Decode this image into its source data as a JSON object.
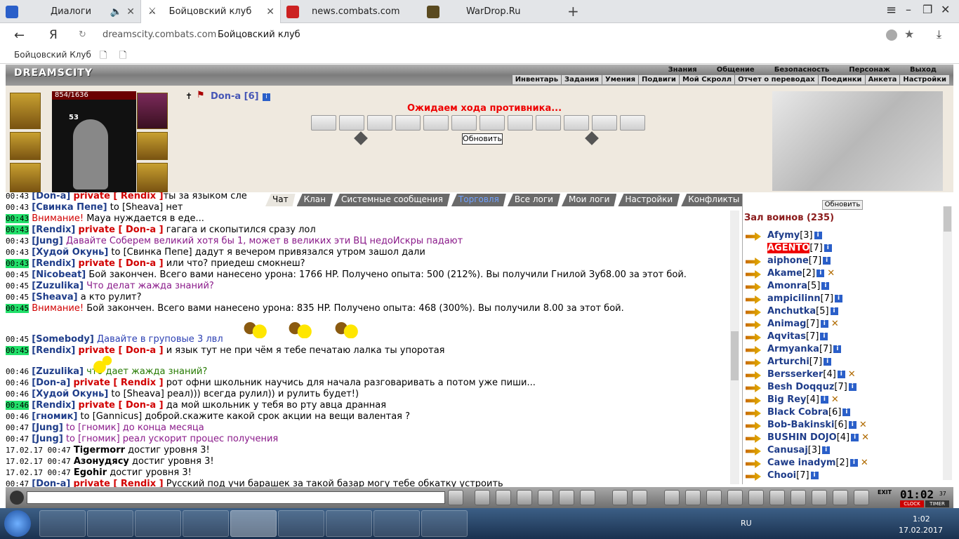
{
  "browser": {
    "tabs": [
      {
        "label": "Диалоги"
      },
      {
        "label": "Бойцовский клуб"
      },
      {
        "label": "news.combats.com"
      },
      {
        "label": "WarDrop.Ru"
      }
    ],
    "url": "dreamscity.combats.com",
    "page_title": "Бойцовский клуб",
    "yandex_logo": "Я",
    "bookmark": "Бойцовский Клуб"
  },
  "game": {
    "logo": "DREAMSCITY",
    "main_menu": [
      "Знания",
      "Общение",
      "Безопасность",
      "Персонаж",
      "Выход"
    ],
    "sub_menu": [
      "Инвентарь",
      "Задания",
      "Умения",
      "Подвиги",
      "Мой Скролл",
      "Отчет о переводах",
      "Поединки",
      "Анкета",
      "Настройки"
    ],
    "hp": "854/1636",
    "slot_count": "53",
    "char_name": "Don-a [6]",
    "status": "Ожидаем хода противника...",
    "refresh": "Обновить",
    "side_refresh": "Обновить"
  },
  "chat_tabs": [
    "Чат",
    "Клан",
    "Системные сообщения",
    "Торговля",
    "Все логи",
    "Мои логи",
    "Настройки",
    "Конфликты"
  ],
  "chat": [
    {
      "t": "00:43",
      "hl": false,
      "n": "[Don-a]",
      "p": "private [ Rendix ]",
      "m": "ты за языком сле"
    },
    {
      "t": "00:43",
      "hl": false,
      "n": "[Свинка Пепе]",
      "m": " to [Sheava] нет"
    },
    {
      "t": "00:43",
      "hl": true,
      "n": "Внимание!",
      "red": true,
      "m": " Мауа нуждается в еде..."
    },
    {
      "t": "00:43",
      "hl": true,
      "n": "[Rendix]",
      "p": "private [ Don-a ]",
      "m": " гагага и скопытился сразу лол"
    },
    {
      "t": "00:43",
      "hl": false,
      "n": "[Jung]",
      "m": " Давайте Соберем великий хотя бы 1, может в великих эти ВЦ недоИскры падают",
      "mc": "pu"
    },
    {
      "t": "00:43",
      "hl": false,
      "n": "[Худой Окунь]",
      "m": " to [Свинка Пепе] дадут я вечером привязался утром зашол дали"
    },
    {
      "t": "00:43",
      "hl": true,
      "n": "[Rendix]",
      "p": "private [ Don-a ]",
      "m": " или что? приедеш смокнеш?"
    },
    {
      "t": "00:45",
      "hl": false,
      "n": "[Nicobeat]",
      "m": " Бой закончен. Всего вами нанесено урона: 1766 HP. Получено опыта: 500 (212%). Вы получили Гнилой Зуб8.00 за этот бой."
    },
    {
      "t": "00:45",
      "hl": false,
      "n": "[Zuzulika]",
      "m": " Что делат жажда знаний?",
      "mc": "pu"
    },
    {
      "t": "00:45",
      "hl": false,
      "n": "[Sheava]",
      "m": " а кто рулит?"
    },
    {
      "t": "00:45",
      "hl": true,
      "n": "Внимание!",
      "red": true,
      "m": " Бой закончен. Всего вами нанесено урона: 835 HP. Получено опыта: 468 (300%). Вы получили 8.00 за этот бой."
    },
    {
      "t": "00:45",
      "hl": false,
      "n": "[Somebody]",
      "m": " Давайте в груповые 3 лвл",
      "mc": "bl"
    },
    {
      "t": "00:45",
      "hl": true,
      "n": "[Rendix]",
      "p": "private [ Don-a ]",
      "m": " и язык тут не при чём я тебе печатаю лалка ты упоротая"
    },
    {
      "t": "00:46",
      "hl": false,
      "n": "[Zuzulika]",
      "m": " что дает жажда знаний?",
      "mc": "gr"
    },
    {
      "t": "00:46",
      "hl": false,
      "n": "[Don-a]",
      "p": "private [ Rendix ]",
      "m": " рот офни школьник научись для начала разговаривать а потом уже пиши..."
    },
    {
      "t": "00:46",
      "hl": false,
      "n": "[Худой Окунь]",
      "m": " to [Sheava] реал))) всегда рулил)) и рулить будет!)"
    },
    {
      "t": "00:46",
      "hl": true,
      "n": "[Rendix]",
      "p": "private [ Don-a ]",
      "m": " да мой школьник у тебя во рту авца дранная"
    },
    {
      "t": "00:46",
      "hl": false,
      "n": "[гномик]",
      "m": " to [Gannicus] доброй.скажите какой срок акции на вещи валентая ?"
    },
    {
      "t": "00:47",
      "hl": false,
      "n": "[Jung]",
      "m": " to [гномик] до конца месяца",
      "mc": "pu"
    },
    {
      "t": "00:47",
      "hl": false,
      "n": "[Jung]",
      "m": " to [гномик] реал ускорит процес получения",
      "mc": "pu"
    },
    {
      "t": "17.02.17 00:47",
      "hl": false,
      "n": "Tigermorr",
      "sys": true,
      "m": " достиг уровня 3!"
    },
    {
      "t": "17.02.17 00:47",
      "hl": false,
      "n": "Азонудясу",
      "sys": true,
      "m": " достиг уровня 3!"
    },
    {
      "t": "17.02.17 00:47",
      "hl": false,
      "n": "Egohir",
      "sys": true,
      "m": " достиг уровня 3!"
    },
    {
      "t": "00:47",
      "hl": false,
      "n": "[Don-a]",
      "p": "private [ Rendix ]",
      "m": " Русский под учи барашек за такой базар могу тебе обкатку устроить"
    }
  ],
  "hall": {
    "title": "Зал воинов (235)",
    "players": [
      {
        "n": "Afymy",
        "l": "[3]"
      },
      {
        "n": "AGENTO",
        "l": "[7]",
        "hl": true
      },
      {
        "n": "aiphone",
        "l": "[7]"
      },
      {
        "n": "Akame",
        "l": "[2]",
        "x": true
      },
      {
        "n": "Amonra",
        "l": "[5]"
      },
      {
        "n": "ampicilinn",
        "l": "[7]"
      },
      {
        "n": "Anchutka",
        "l": "[5]"
      },
      {
        "n": "Animag",
        "l": "[7]",
        "x": true
      },
      {
        "n": "Aqvitas",
        "l": "[7]"
      },
      {
        "n": "Armyanka",
        "l": "[7]"
      },
      {
        "n": "Arturchi",
        "l": "[7]"
      },
      {
        "n": "Bersserker",
        "l": "[4]",
        "x": true
      },
      {
        "n": "Besh Doqquz",
        "l": "[7]"
      },
      {
        "n": "Big Rey",
        "l": "[4]",
        "x": true
      },
      {
        "n": "Black Cobra",
        "l": "[6]"
      },
      {
        "n": "Bob-Bakinski",
        "l": "[6]",
        "x": true
      },
      {
        "n": "BUSHIN DOJO",
        "l": "[4]",
        "x": true
      },
      {
        "n": "Canusaj",
        "l": "[3]"
      },
      {
        "n": "Cawe inadym",
        "l": "[2]",
        "x": true
      },
      {
        "n": "Chooi",
        "l": "[7]"
      }
    ]
  },
  "timer": {
    "clock": "01:02",
    "sec": "37",
    "clock_label": "CLOCK",
    "timer_label": "TIMER",
    "exit": "EXIT"
  },
  "taskbar": {
    "lang": "RU",
    "time": "1:02",
    "date": "17.02.2017"
  }
}
